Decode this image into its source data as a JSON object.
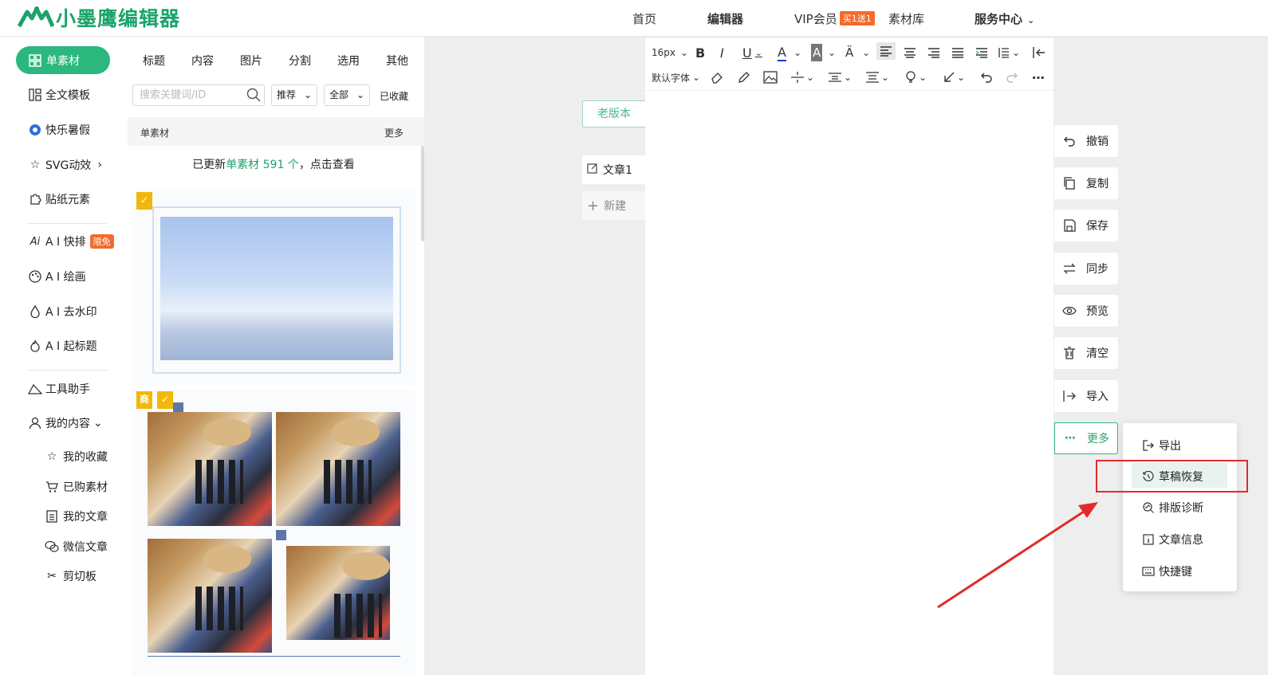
{
  "header": {
    "logo_text": "小墨鹰编辑器",
    "nav": [
      {
        "label": "首页"
      },
      {
        "label": "编辑器"
      },
      {
        "label": "VIP会员",
        "badge": "买1送1"
      },
      {
        "label": "素材库"
      },
      {
        "label": "服务中心"
      }
    ]
  },
  "left_nav": {
    "items": [
      {
        "label": "单素材",
        "icon": "grid-icon",
        "active": true
      },
      {
        "label": "全文模板",
        "icon": "template-icon"
      },
      {
        "label": "快乐暑假",
        "icon": "ball-icon"
      },
      {
        "label": "SVG动效",
        "icon": "star-icon"
      },
      {
        "label": "贴纸元素",
        "icon": "puzzle-icon"
      },
      {
        "label": "A I 快排",
        "icon": "ai-icon",
        "badge": "限免"
      },
      {
        "label": "A I 绘画",
        "icon": "palette-icon"
      },
      {
        "label": "A I 去水印",
        "icon": "drop-icon"
      },
      {
        "label": "A I 起标题",
        "icon": "fire-icon"
      },
      {
        "label": "工具助手",
        "icon": "ruler-icon"
      },
      {
        "label": "我的内容",
        "icon": "user-icon"
      }
    ],
    "sub_items": [
      {
        "label": "我的收藏",
        "icon": "star-outline-icon"
      },
      {
        "label": "已购素材",
        "icon": "cart-icon"
      },
      {
        "label": "我的文章",
        "icon": "doc-icon"
      },
      {
        "label": "微信文章",
        "icon": "wechat-icon"
      },
      {
        "label": "剪切板",
        "icon": "scissors-icon"
      }
    ]
  },
  "material_panel": {
    "tabs": [
      "标题",
      "内容",
      "图片",
      "分割",
      "选用",
      "其他"
    ],
    "search_placeholder": "搜索关键词/ID",
    "filter_sort": "推荐",
    "filter_scope": "全部",
    "favorites_label": "已收藏",
    "section_title": "单素材",
    "section_more": "更多",
    "notice_prefix": "已更新",
    "notice_highlight": "单素材 591 个",
    "notice_suffix": "，点击查看",
    "badge_shang": "商"
  },
  "articles": {
    "old_version": "老版本",
    "current": "文章1",
    "new": "新建"
  },
  "toolbar": {
    "font_size": "16px",
    "font_family": "默认字体"
  },
  "right_side": [
    {
      "label": "撤销",
      "icon": "undo-icon"
    },
    {
      "label": "复制",
      "icon": "copy-icon"
    },
    {
      "label": "保存",
      "icon": "save-icon"
    },
    {
      "label": "同步",
      "icon": "sync-icon"
    },
    {
      "label": "预览",
      "icon": "eye-icon"
    },
    {
      "label": "清空",
      "icon": "trash-icon"
    },
    {
      "label": "导入",
      "icon": "import-icon"
    },
    {
      "label": "更多",
      "icon": "more-dots-icon"
    }
  ],
  "more_menu": [
    {
      "label": "导出",
      "icon": "export-icon"
    },
    {
      "label": "草稿恢复",
      "icon": "history-icon",
      "highlighted": true
    },
    {
      "label": "排版诊断",
      "icon": "diagnose-icon"
    },
    {
      "label": "文章信息",
      "icon": "info-icon"
    },
    {
      "label": "快捷键",
      "icon": "keyboard-icon"
    }
  ],
  "colors": {
    "brand": "#2cb77e",
    "badge": "#f36b2b",
    "annotation": "#e22a2a"
  }
}
